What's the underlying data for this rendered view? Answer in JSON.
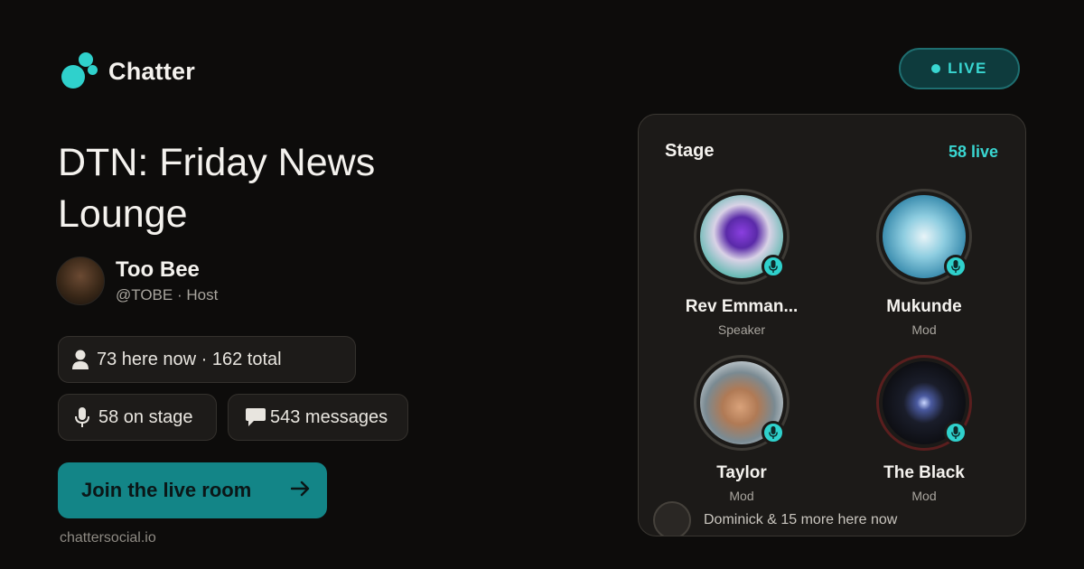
{
  "brand": {
    "name": "Chatter",
    "accent": "#2fd1cc",
    "button_color": "#138587"
  },
  "room": {
    "title": "DTN: Friday News Lounge"
  },
  "host": {
    "name": "Too Bee",
    "handle_role": "@TOBE · Host"
  },
  "stats": {
    "presence": "73 here now · 162 total",
    "on_stage": "58 on stage",
    "messages": "543 messages"
  },
  "cta": {
    "label": "Join the live room",
    "arrow": "→"
  },
  "domain": "chattersocial.io",
  "live_badge": "LIVE",
  "stage": {
    "title": "Stage",
    "count": "58 live",
    "speakers": [
      {
        "name": "Rev Emman...",
        "role": "Speaker",
        "icon": "mic-icon"
      },
      {
        "name": "Mukunde",
        "role": "Mod",
        "icon": "mic-icon"
      },
      {
        "name": "Taylor",
        "role": "Mod",
        "icon": "mic-icon"
      },
      {
        "name": "The Black",
        "role": "Mod",
        "icon": "mic-icon"
      }
    ],
    "footer": "Dominick & 15 more here now"
  }
}
